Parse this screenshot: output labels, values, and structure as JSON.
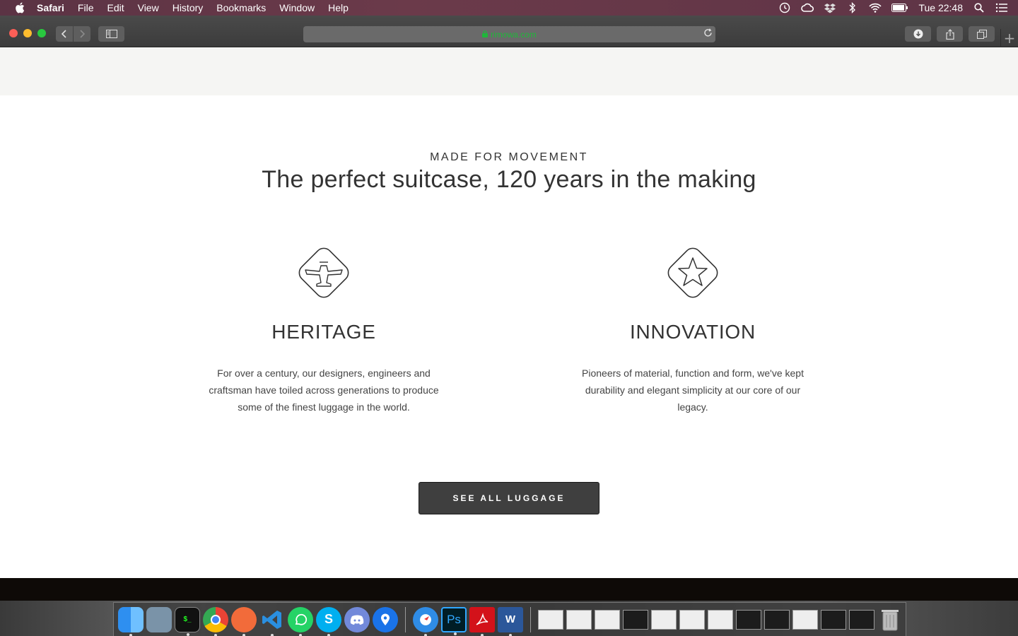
{
  "menubar": {
    "app_name": "Safari",
    "menus": [
      "File",
      "Edit",
      "View",
      "History",
      "Bookmarks",
      "Window",
      "Help"
    ],
    "clock": "Tue 22:48"
  },
  "browser": {
    "url": "rimowa.com"
  },
  "section": {
    "eyebrow": "MADE FOR MOVEMENT",
    "headline": "The perfect suitcase, 120 years in the making"
  },
  "features": [
    {
      "title": "HERITAGE",
      "icon": "airplane-icon",
      "description": "For over a century, our designers, engineers and craftsman have toiled across generations to produce some of the finest luggage in the world."
    },
    {
      "title": "INNOVATION",
      "icon": "star-icon",
      "description": "Pioneers of material, function and form, we've kept durability and elegant simplicity at our core of our legacy."
    }
  ],
  "cta": {
    "label": "SEE ALL LUGGAGE"
  },
  "colors": {
    "menubar": "#5e3446",
    "cta_bg": "#3f3f3f",
    "text": "#333333",
    "secure_url": "#1fb73a"
  },
  "dock": {
    "apps": [
      "finder-icon",
      "preview-icon",
      "terminal-icon",
      "chrome-icon",
      "pencil-app-icon",
      "vscode-icon",
      "whatsapp-icon",
      "skype-icon",
      "discord-icon",
      "maps-pin-icon",
      "safari-icon",
      "photoshop-icon",
      "acrobat-icon",
      "word-icon"
    ],
    "ps_label": "Ps",
    "word_label": "W",
    "skype_label": "S"
  }
}
